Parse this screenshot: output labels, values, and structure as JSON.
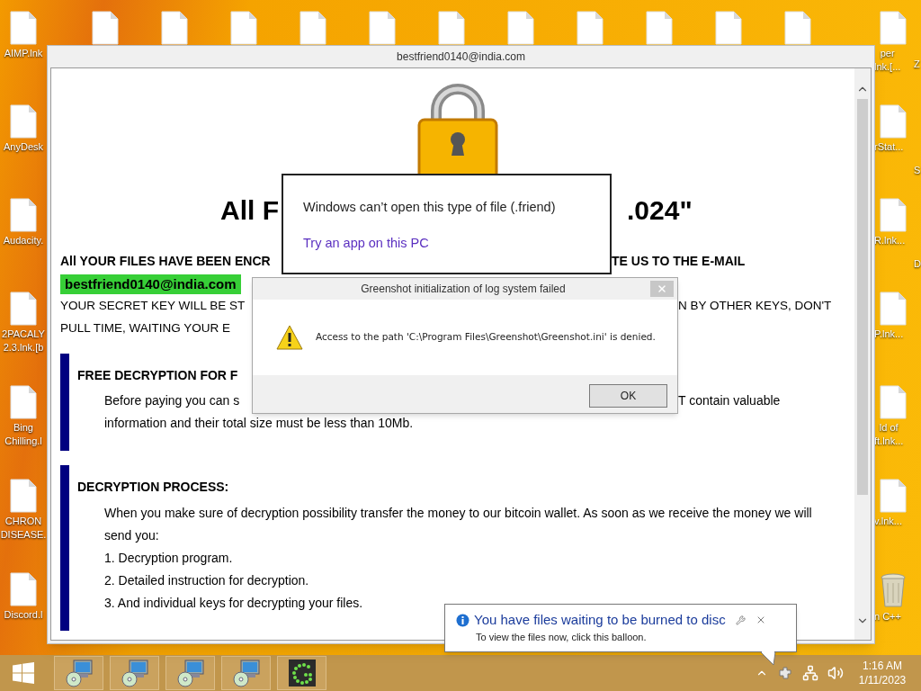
{
  "desktop": {
    "icons_left": [
      {
        "kind": "file",
        "label": "AIMP.lnk"
      },
      {
        "kind": "file",
        "label": "AnyDesk"
      },
      {
        "kind": "file",
        "label": "Audacity."
      },
      {
        "kind": "file",
        "label": "2PACALY\n2.3.lnk.[b"
      },
      {
        "kind": "file",
        "label": "Bing\nChilling.l"
      },
      {
        "kind": "file",
        "label": "CHRON\nDISEASE."
      },
      {
        "kind": "file",
        "label": "Discord.l"
      }
    ],
    "icons_right": [
      {
        "kind": "file",
        "label": "per\nlnk.[..."
      },
      {
        "kind": "file",
        "label": "rStat..."
      },
      {
        "kind": "file",
        "label": "R.lnk..."
      },
      {
        "kind": "file",
        "label": "P.lnk..."
      },
      {
        "kind": "file",
        "label": "ld of\nft.lnk..."
      },
      {
        "kind": "file",
        "label": "v.lnk..."
      },
      {
        "kind": "recycle-bin",
        "label": "n C++"
      }
    ],
    "edge_labels": [
      "Z",
      "S",
      "D"
    ]
  },
  "note_window": {
    "title": "bestfriend0140@india.com",
    "heading": {
      "left": "All F",
      "right": ".024\""
    },
    "intro": [
      {
        "kind": "bold",
        "left": "All YOUR FILES HAVE BEEN ENCR",
        "right": "TE US TO THE E-MAIL"
      },
      {
        "kind": "email",
        "text": "bestfriend0140@india.com"
      },
      {
        "kind": "plain",
        "left": "YOUR SECRET KEY WILL BE ST",
        "right": "N BY OTHER KEYS, DON'T"
      },
      {
        "kind": "plain",
        "left": "PULL TIME, WAITING YOUR E"
      }
    ],
    "sections": [
      {
        "heading": "FREE DECRYPTION FOR F",
        "lines": [
          {
            "left": "Before paying you can s",
            "right": "T contain valuable"
          },
          {
            "left": "information and their total size must be less than 10Mb."
          }
        ]
      },
      {
        "heading": "DECRYPTION PROCESS:",
        "paragraph": "When you make sure of decryption possibility transfer the money to our bitcoin wallet. As soon as we receive the money we will send you:",
        "items": [
          "1. Decryption program.",
          "2. Detailed instruction for decryption.",
          "3. And individual keys for decrypting your files."
        ]
      }
    ]
  },
  "open_with_dialog": {
    "message": "Windows can’t open this type of file (.friend)",
    "link": "Try an app on this PC"
  },
  "error_dialog": {
    "title": "Greenshot initialization of log system failed",
    "message": "Access to the path 'C:\\Program Files\\Greenshot\\Greenshot.ini' is denied.",
    "buttons": [
      "OK"
    ]
  },
  "balloon": {
    "title": "You have files waiting to be burned to disc",
    "text": "To view the files now, click this balloon."
  },
  "taskbar": {
    "apps": [
      {
        "kind": "installer"
      },
      {
        "kind": "installer"
      },
      {
        "kind": "installer"
      },
      {
        "kind": "installer"
      },
      {
        "kind": "greenshot"
      }
    ],
    "clock": {
      "time": "1:16 AM",
      "date": "1/11/2023"
    }
  }
}
